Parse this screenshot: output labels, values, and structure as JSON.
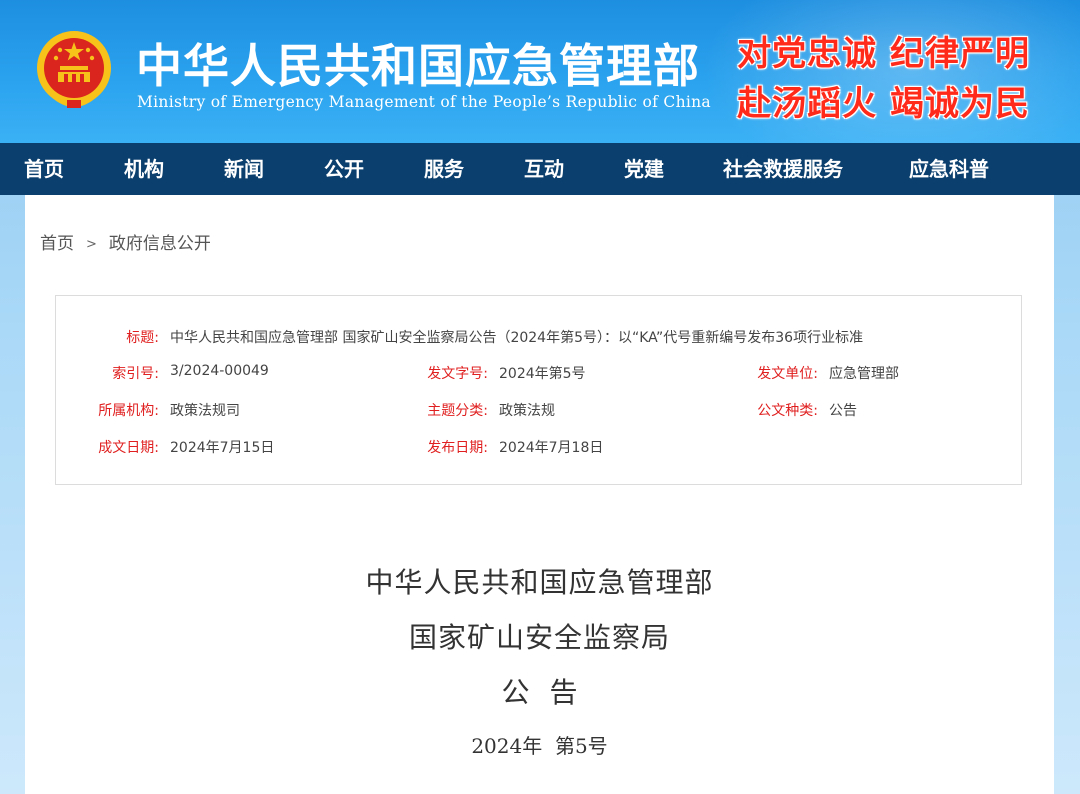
{
  "header": {
    "title": "中华人民共和国应急管理部",
    "subtitle": "Ministry of Emergency Management of the People’s Republic of China",
    "slogan_line1": "对党忠诚 纪律严明",
    "slogan_line2": "赴汤蹈火 竭诚为民",
    "emblem_icon": "national-emblem-icon",
    "colors": {
      "header_blue": "#2aa2ee",
      "nav_bg": "#0b3f6d",
      "slogan_red": "#ff2a1a",
      "label_red": "#e02020"
    }
  },
  "nav": {
    "items": [
      {
        "label": "首页"
      },
      {
        "label": "机构"
      },
      {
        "label": "新闻"
      },
      {
        "label": "公开"
      },
      {
        "label": "服务"
      },
      {
        "label": "互动"
      },
      {
        "label": "党建"
      },
      {
        "label": "社会救援服务"
      },
      {
        "label": "应急科普"
      }
    ]
  },
  "breadcrumb": {
    "home": "首页",
    "separator": ">",
    "current": "政府信息公开"
  },
  "meta": {
    "title_label": "标题:",
    "title_value": "中华人民共和国应急管理部 国家矿山安全监察局公告（2024年第5号）：以“KA”代号重新编号发布36项行业标准",
    "index_label": "索引号:",
    "index_value": "3/2024-00049",
    "docno_label": "发文字号:",
    "docno_value": "2024年第5号",
    "issuer_label": "发文单位:",
    "issuer_value": "应急管理部",
    "org_label": "所属机构:",
    "org_value": "政策法规司",
    "topic_label": "主题分类:",
    "topic_value": "政策法规",
    "type_label": "公文种类:",
    "type_value": "公告",
    "created_label": "成文日期:",
    "created_value": "2024年7月15日",
    "published_label": "发布日期:",
    "published_value": "2024年7月18日"
  },
  "document": {
    "heading1": "中华人民共和国应急管理部",
    "heading2": "国家矿山安全监察局",
    "heading3": "公告",
    "number": "2024年  第5号"
  }
}
